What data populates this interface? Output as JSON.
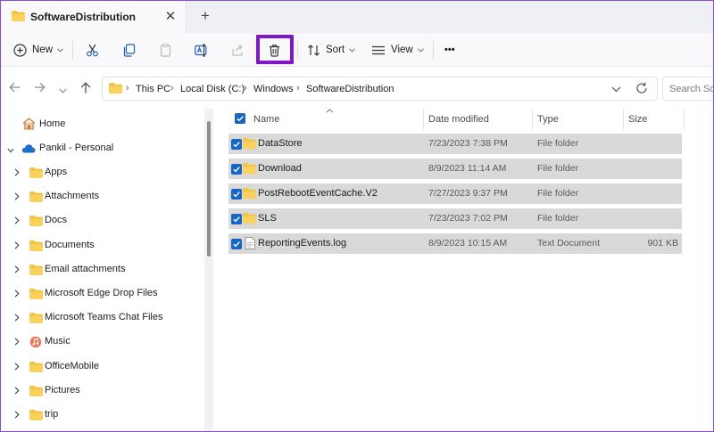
{
  "tab": {
    "title": "SoftwareDistribution",
    "close": "✕",
    "new_tab": "+"
  },
  "toolbar": {
    "new_label": "New",
    "sort_label": "Sort",
    "view_label": "View",
    "more_label": "•••"
  },
  "address": {
    "crumbs": [
      "This PC",
      "Local Disk (C:)",
      "Windows",
      "SoftwareDistribution"
    ],
    "separator": "›"
  },
  "search": {
    "placeholder": "Search SoftwareDistribution"
  },
  "nav": {
    "items": [
      {
        "label": "Home",
        "icon": "home-icon"
      },
      {
        "label": "Pankil - Personal",
        "icon": "onedrive-icon"
      },
      {
        "label": "Apps",
        "icon": "folder-icon"
      },
      {
        "label": "Attachments",
        "icon": "folder-icon"
      },
      {
        "label": "Docs",
        "icon": "folder-icon"
      },
      {
        "label": "Documents",
        "icon": "folder-icon"
      },
      {
        "label": "Email attachments",
        "icon": "folder-icon"
      },
      {
        "label": "Microsoft Edge Drop Files",
        "icon": "folder-icon"
      },
      {
        "label": "Microsoft Teams Chat Files",
        "icon": "folder-icon"
      },
      {
        "label": "Music",
        "icon": "music-folder-icon"
      },
      {
        "label": "OfficeMobile",
        "icon": "folder-icon"
      },
      {
        "label": "Pictures",
        "icon": "folder-icon"
      },
      {
        "label": "trip",
        "icon": "folder-icon"
      }
    ]
  },
  "list": {
    "columns": [
      "Name",
      "Date modified",
      "Type",
      "Size"
    ],
    "rows": [
      {
        "name": "DataStore",
        "date": "7/23/2023 7:38 PM",
        "type": "File folder",
        "size": "",
        "icon": "folder-icon"
      },
      {
        "name": "Download",
        "date": "8/9/2023 11:14 AM",
        "type": "File folder",
        "size": "",
        "icon": "folder-icon"
      },
      {
        "name": "PostRebootEventCache.V2",
        "date": "7/27/2023 9:37 PM",
        "type": "File folder",
        "size": "",
        "icon": "folder-icon"
      },
      {
        "name": "SLS",
        "date": "7/23/2023 7:02 PM",
        "type": "File folder",
        "size": "",
        "icon": "folder-icon"
      },
      {
        "name": "ReportingEvents.log",
        "date": "8/9/2023 10:15 AM",
        "type": "Text Document",
        "size": "901 KB",
        "icon": "text-document-icon"
      }
    ]
  },
  "colors": {
    "accent": "#1666c2",
    "highlight_box": "#7d17c7",
    "folder": "#f3c544",
    "selection": "#d9d9d9"
  }
}
